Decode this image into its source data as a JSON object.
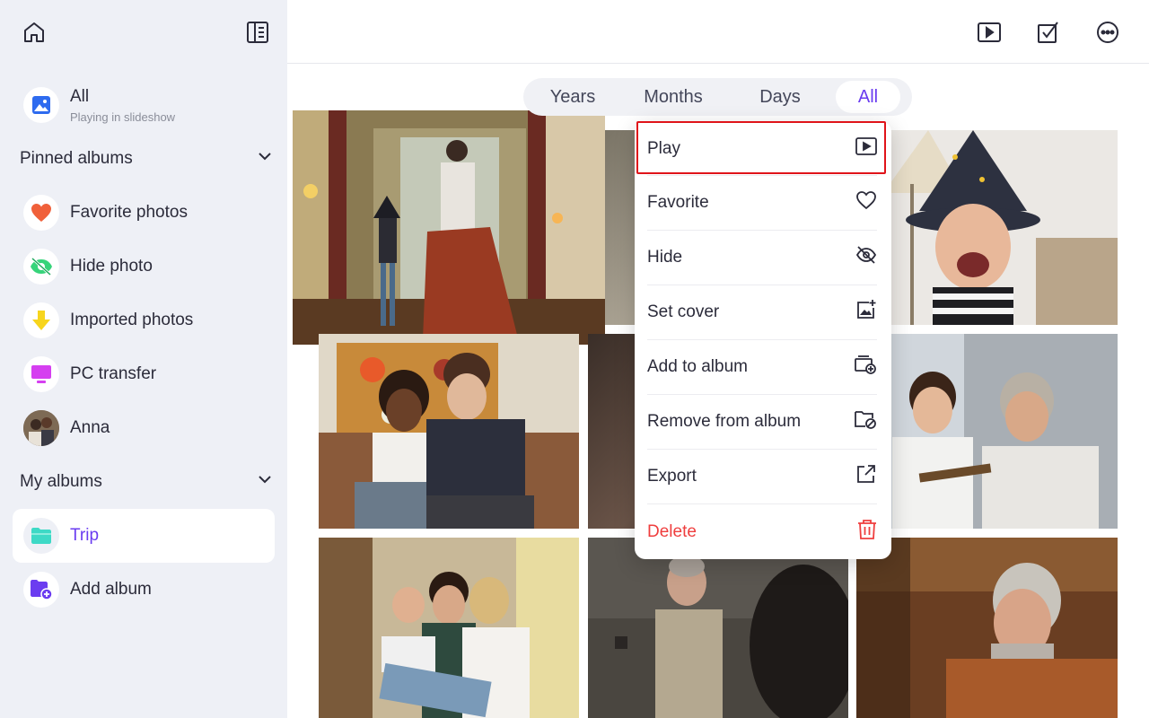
{
  "sidebar": {
    "all": {
      "label": "All",
      "subtitle": "Playing in slideshow"
    },
    "pinned_header": "Pinned albums",
    "pinned": [
      {
        "label": "Favorite photos",
        "icon": "heart-icon"
      },
      {
        "label": "Hide photo",
        "icon": "eye-off-icon"
      },
      {
        "label": "Imported photos",
        "icon": "download-arrow-icon"
      },
      {
        "label": "PC transfer",
        "icon": "monitor-icon"
      },
      {
        "label": "Anna",
        "icon": "person-avatar"
      }
    ],
    "albums_header": "My albums",
    "albums": [
      {
        "label": "Trip",
        "icon": "folder-icon",
        "active": true
      },
      {
        "label": "Add album",
        "icon": "add-album-icon"
      }
    ]
  },
  "view_tabs": [
    {
      "label": "Years"
    },
    {
      "label": "Months"
    },
    {
      "label": "Days"
    },
    {
      "label": "All",
      "active": true
    }
  ],
  "context_menu": {
    "items": [
      {
        "label": "Play",
        "icon": "play-icon"
      },
      {
        "label": "Favorite",
        "icon": "heart-outline-icon"
      },
      {
        "label": "Hide",
        "icon": "eye-off-icon"
      },
      {
        "label": "Set cover",
        "icon": "set-cover-icon"
      },
      {
        "label": "Add to album",
        "icon": "add-to-album-icon"
      },
      {
        "label": "Remove from album",
        "icon": "remove-folder-icon"
      },
      {
        "label": "Export",
        "icon": "export-icon"
      },
      {
        "label": "Delete",
        "icon": "trash-icon",
        "danger": true
      }
    ]
  },
  "colors": {
    "accent": "#6a3cf0",
    "danger": "#ef3e3e",
    "highlight_box": "#e0141a",
    "sidebar_bg": "#eef0f6"
  }
}
